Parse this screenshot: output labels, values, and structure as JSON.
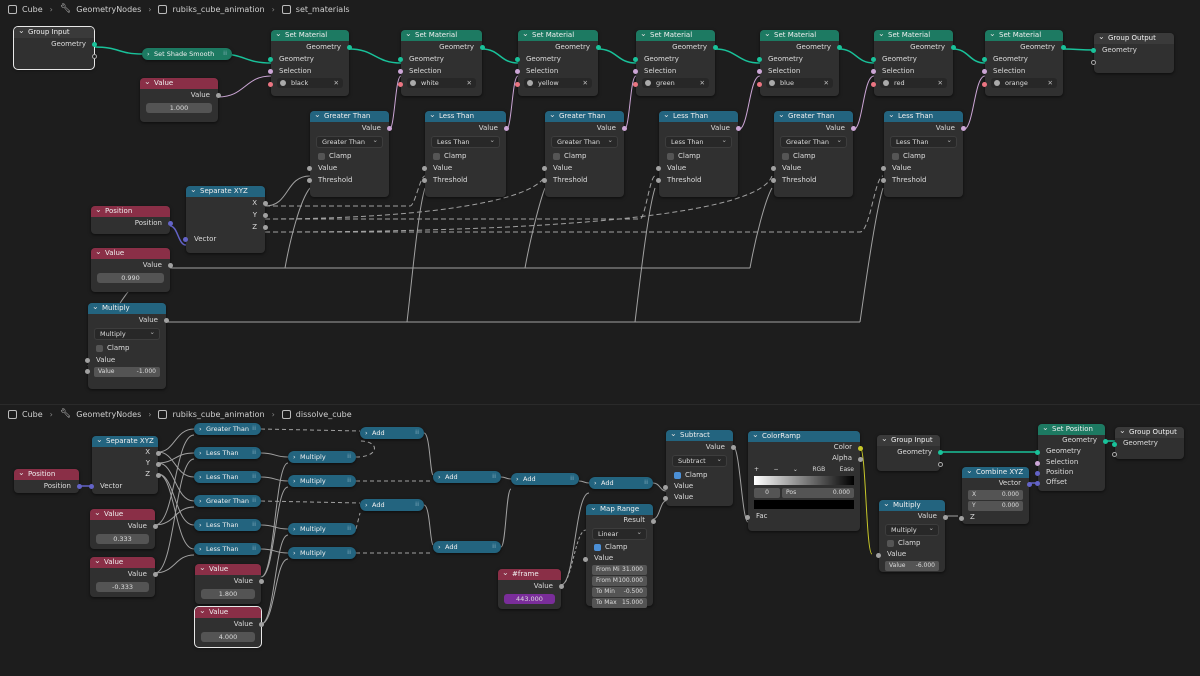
{
  "editor1": {
    "breadcrumb": [
      "Cube",
      "GeometryNodes",
      "rubiks_cube_animation",
      "set_materials"
    ]
  },
  "editor2": {
    "breadcrumb": [
      "Cube",
      "GeometryNodes",
      "rubiks_cube_animation",
      "dissolve_cube"
    ]
  },
  "labels": {
    "geometry": "Geometry",
    "selection": "Selection",
    "value": "Value",
    "threshold": "Threshold",
    "clamp": "Clamp",
    "position": "Position",
    "vector": "Vector",
    "x": "X",
    "y": "Y",
    "z": "Z",
    "result": "Result",
    "fac": "Fac",
    "color": "Color",
    "alpha": "Alpha",
    "offset": "Offset",
    "pos": "Pos"
  },
  "nodes1": {
    "group_input": "Group Input",
    "shade_smooth": "Set Shade Smooth",
    "value_node": {
      "title": "Value",
      "value": "1.000"
    },
    "set_material_title": "Set Material",
    "materials": [
      "black",
      "white",
      "yellow",
      "green",
      "blue",
      "red",
      "orange"
    ],
    "group_output": "Group Output",
    "compares": [
      {
        "title": "Greater Than",
        "op": "Greater Than"
      },
      {
        "title": "Less Than",
        "op": "Less Than"
      },
      {
        "title": "Greater Than",
        "op": "Greater Than"
      },
      {
        "title": "Less Than",
        "op": "Less Than"
      },
      {
        "title": "Greater Than",
        "op": "Greater Than"
      },
      {
        "title": "Less Than",
        "op": "Less Than"
      }
    ],
    "separate_xyz": "Separate XYZ",
    "position_node": "Position",
    "value_090": {
      "title": "Value",
      "value": "0.990"
    },
    "multiply": {
      "title": "Multiply",
      "op": "Multiply",
      "value_label": "Value",
      "value": "-1.000"
    }
  },
  "nodes2": {
    "position_node": "Position",
    "separate_xyz": "Separate XYZ",
    "value_a": {
      "title": "Value",
      "value": "0.333"
    },
    "value_b": {
      "title": "Value",
      "value": "-0.333"
    },
    "compares": [
      "Greater Than",
      "Less Than",
      "Less Than",
      "Greater Than",
      "Less Than",
      "Less Than"
    ],
    "value_c": {
      "title": "Value",
      "value": "1.800"
    },
    "value_d": {
      "title": "Value",
      "value": "4.000"
    },
    "multiplies": [
      "Multiply",
      "Multiply",
      "Multiply",
      "Multiply"
    ],
    "adds": [
      "Add",
      "Add",
      "Add",
      "Add",
      "Add"
    ],
    "map_range": {
      "title": "Map Range",
      "mode": "Linear",
      "fields": [
        {
          "k": "From Mi",
          "v": "31.000"
        },
        {
          "k": "From M",
          "v": "100.000"
        },
        {
          "k": "To Min",
          "v": "-0.500"
        },
        {
          "k": "To Max",
          "v": "15.000"
        }
      ]
    },
    "frame": {
      "title": "#frame",
      "value": "443.000"
    },
    "subtract": {
      "title": "Subtract",
      "op": "Subtract"
    },
    "color_ramp": {
      "title": "ColorRamp",
      "mode": "RGB",
      "interp": "Ease",
      "index": "0",
      "pos": "0.000",
      "plus": "+",
      "minus": "−"
    },
    "group_input": "Group Input",
    "multiply_b": {
      "title": "Multiply",
      "op": "Multiply",
      "value": "-6.000"
    },
    "combine_xyz": {
      "title": "Combine XYZ",
      "x": "0.000",
      "y": "0.000"
    },
    "set_position": "Set Position",
    "group_output": "Group Output"
  }
}
